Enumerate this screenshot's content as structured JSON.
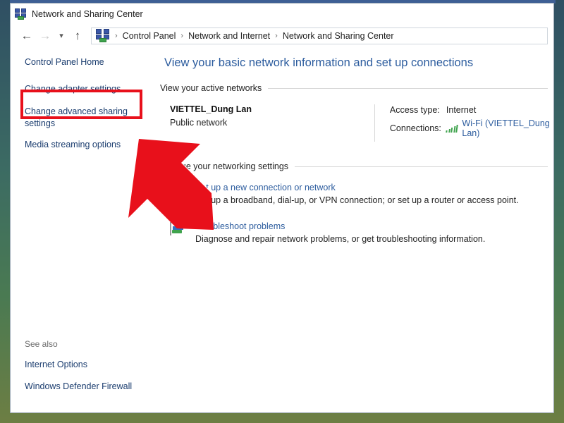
{
  "window": {
    "title": "Network and Sharing Center",
    "title_icon": "network-icon"
  },
  "nav": {
    "back_icon": "arrow-left-icon",
    "forward_icon": "arrow-right-icon",
    "recent_icon": "chevron-down-icon",
    "up_icon": "arrow-up-icon",
    "address_icon": "network-icon",
    "breadcrumbs": [
      "Control Panel",
      "Network and Internet",
      "Network and Sharing Center"
    ],
    "separator": "›"
  },
  "sidebar": {
    "items": [
      {
        "label": "Control Panel Home"
      },
      {
        "label": "Change adapter settings"
      },
      {
        "label": "Change advanced sharing settings"
      },
      {
        "label": "Media streaming options"
      }
    ],
    "see_also": {
      "heading": "See also",
      "items": [
        {
          "label": "Internet Options"
        },
        {
          "label": "Windows Defender Firewall"
        }
      ]
    }
  },
  "main": {
    "page_title": "View your basic network information and set up connections",
    "active_networks_heading": "View your active networks",
    "active_network": {
      "name": "VIETTEL_Dung Lan",
      "type": "Public network",
      "access_type_label": "Access type:",
      "access_type_value": "Internet",
      "connections_label": "Connections:",
      "connections_value": "Wi-Fi (VIETTEL_Dung Lan)",
      "connections_icon": "wifi-signal-icon"
    },
    "networking_settings_heading": "Change your networking settings",
    "tasks": [
      {
        "link": "Set up a new connection or network",
        "description": "Set up a broadband, dial-up, or VPN connection; or set up a router or access point.",
        "icon": "new-connection-icon"
      },
      {
        "link": "Troubleshoot problems",
        "description": "Diagnose and repair network problems, or get troubleshooting information.",
        "icon": "troubleshoot-icon"
      }
    ]
  },
  "annotations": {
    "highlight_box": {
      "color": "#e8101b",
      "target": "Change advanced sharing settings"
    },
    "arrow": {
      "color": "#e8101b",
      "direction": "up-left",
      "points_at": "Change advanced sharing settings"
    }
  }
}
